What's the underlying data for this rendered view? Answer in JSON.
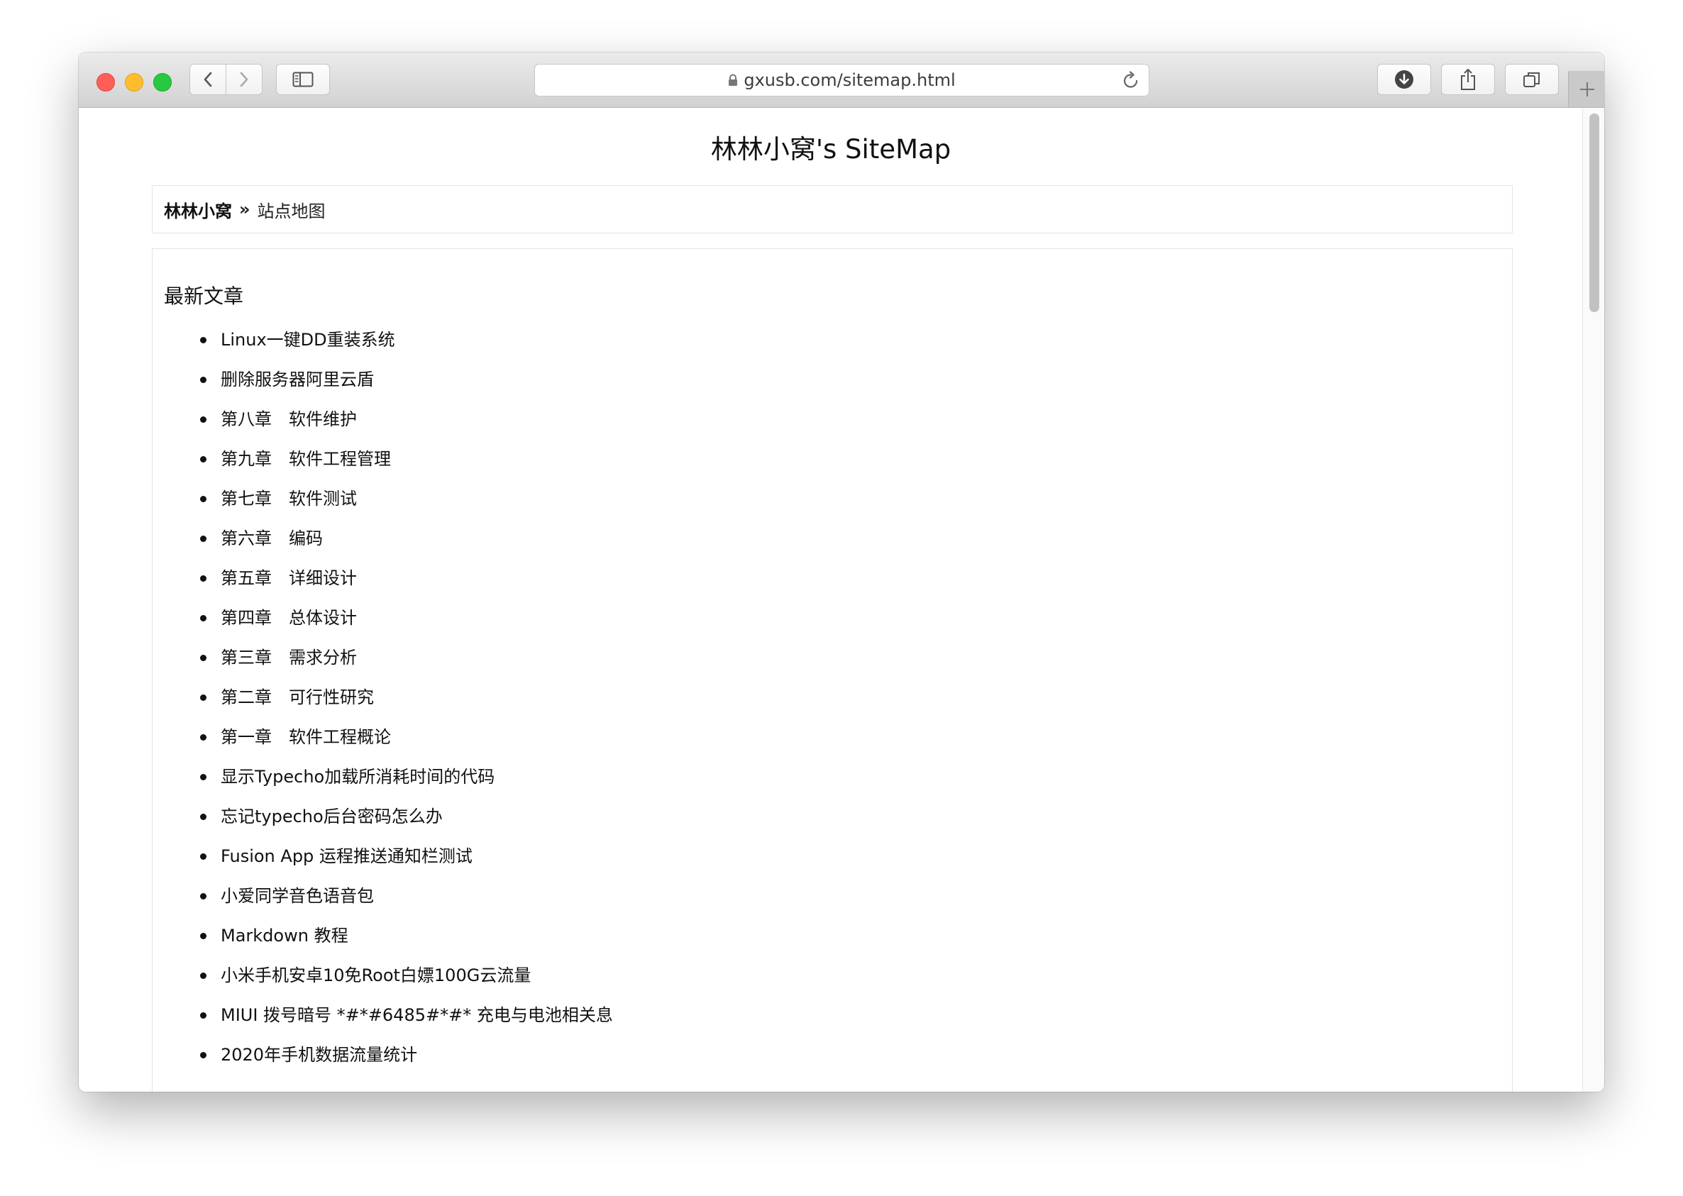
{
  "browser": {
    "url": "gxusb.com/sitemap.html"
  },
  "page": {
    "title": "林林小窝's SiteMap",
    "breadcrumb": {
      "home": "林林小窝",
      "separator": "»",
      "current": "站点地图"
    },
    "section_heading": "最新文章",
    "articles": [
      "Linux一键DD重装系统",
      "删除服务器阿里云盾",
      "第八章　软件维护",
      "第九章　软件工程管理",
      "第七章　软件测试",
      "第六章　编码",
      "第五章　详细设计",
      "第四章　总体设计",
      "第三章　需求分析",
      "第二章　可行性研究",
      "第一章　软件工程概论",
      "显示Typecho加载所消耗时间的代码",
      "忘记typecho后台密码怎么办",
      "Fusion App 运程推送通知栏测试",
      "小爱同学音色语音包",
      "Markdown 教程",
      "小米手机安卓10免Root白嫖100G云流量",
      "MIUI 拨号暗号 *#*#6485#*#* 充电与电池相关息",
      "2020年手机数据流量统计"
    ]
  },
  "colors": {
    "close": "#ff5f57",
    "minimize": "#ffbd2e",
    "maximize": "#28c940"
  },
  "icons": {
    "back": "chevron-left-icon",
    "forward": "chevron-right-icon",
    "sidebar": "sidebar-icon",
    "lock": "lock-icon",
    "reload": "reload-icon",
    "download": "download-icon",
    "share": "share-icon",
    "tabs": "tabs-overview-icon",
    "new_tab": "plus-icon"
  }
}
